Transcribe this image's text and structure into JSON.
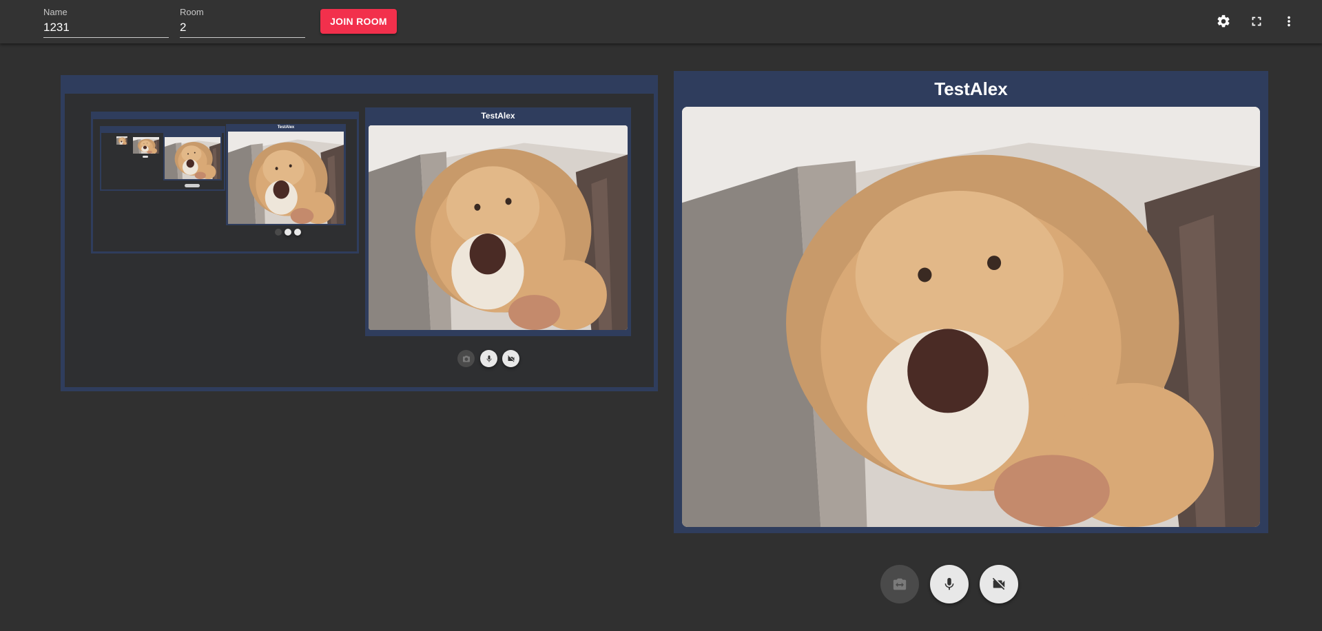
{
  "toolbar": {
    "name_label": "Name",
    "name_value": "1231",
    "room_label": "Room",
    "room_value": "2",
    "join_label": "JOIN ROOM",
    "accent": "#f2304c",
    "icons": [
      "gear-icon",
      "fullscreen-icon",
      "more-vert-icon"
    ]
  },
  "remote": {
    "participant": "TestAlex",
    "panel_color": "#2f3d5d",
    "controls": [
      "switch-camera-icon",
      "microphone-icon",
      "video-off-icon"
    ]
  },
  "local": {
    "nested_participant": "TestAlex",
    "nested_small_participant": "TestAlex"
  }
}
